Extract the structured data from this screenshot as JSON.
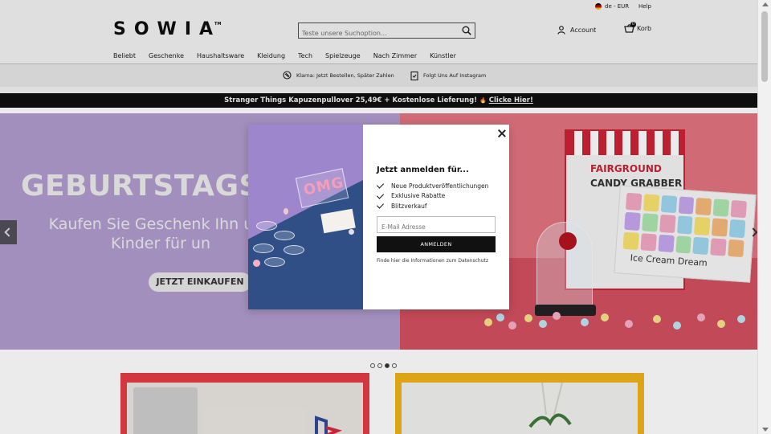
{
  "topbar": {
    "locale": "de - EUR",
    "help": "Help"
  },
  "header": {
    "logo": "SOWIA",
    "logo_mark": "TM",
    "search_placeholder": "Teste unsere Suchoption...",
    "account_label": "Account",
    "basket_label": "Korb",
    "basket_count": "0"
  },
  "nav": {
    "items": [
      "Beliebt",
      "Geschenke",
      "Haushaltsware",
      "Kleidung",
      "Tech",
      "Spielzeuge",
      "Nach Zimmer",
      "Künstler"
    ]
  },
  "usp": {
    "klarna": "Klarna: Jetzt Bestellen, Später Zahlen",
    "instagram": "Folgt Uns Auf Instagram"
  },
  "promo": {
    "text": "Stranger Things Kapuzenpullover 25,49€ + Kostenlose Lieferung!",
    "emoji": "🔥",
    "link": "Clicke Hier!"
  },
  "hero": {
    "title": "GEBURTSTAGSGE",
    "subtitle": "Kaufen Sie Geschenk Ihn und Kinder für un",
    "button": "JETZT EINKAUFEN",
    "candy_box_line1": "FAIRGROUND",
    "candy_box_line2": "CANDY GRABBER",
    "ice_label": "Ice Cream Dream",
    "slides_total": 4,
    "slide_active": 3
  },
  "modal": {
    "neon_text": "OMG",
    "title": "Jetzt anmelden für...",
    "benefits": [
      "Neue Produktveröffentlichungen",
      "Exklusive Rabatte",
      "Blitzverkauf"
    ],
    "email_placeholder": "E-Mail Adresse",
    "signup_button": "ANMELDEN",
    "privacy_text": "Finde hier die Informationen zum Datenschutz"
  },
  "colors": {
    "hero_left": "#b09cce",
    "hero_right": "#d3505f",
    "tile1_border": "#e43b44",
    "tile2_border": "#f0b21a",
    "promo_bar": "#111111"
  }
}
